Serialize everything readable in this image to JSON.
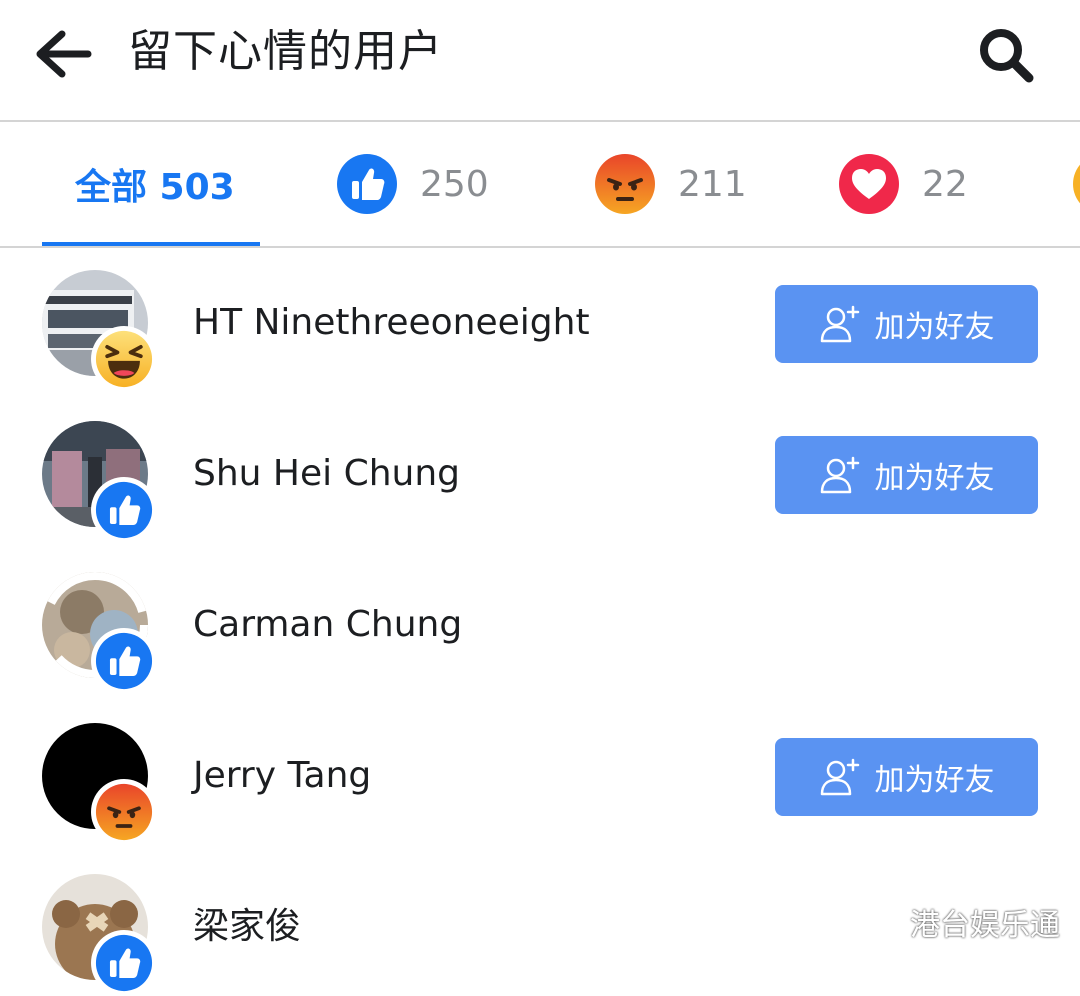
{
  "header": {
    "title": "留下心情的用户"
  },
  "tabs": [
    {
      "label": "全部 503"
    },
    {
      "reaction": "like",
      "count": "250"
    },
    {
      "reaction": "angry",
      "count": "211"
    },
    {
      "reaction": "love",
      "count": "22"
    },
    {
      "reaction": "haha",
      "count": ""
    }
  ],
  "users": [
    {
      "name": "HT Ninethreeoneeight",
      "reaction": "haha",
      "button": "加为好友"
    },
    {
      "name": "Shu Hei Chung",
      "reaction": "like",
      "button": "加为好友"
    },
    {
      "name": "Carman Chung",
      "reaction": "like",
      "button": ""
    },
    {
      "name": "Jerry Tang",
      "reaction": "angry",
      "button": "加为好友"
    },
    {
      "name": "梁家俊",
      "reaction": "like",
      "button": ""
    }
  ],
  "watermark": "港台娱乐通",
  "colors": {
    "accent": "#1877f2",
    "button": "#5a93f2",
    "like": "#1877f2",
    "angry": "#f0652a",
    "love": "#f0284a",
    "haha": "#f7b125"
  }
}
